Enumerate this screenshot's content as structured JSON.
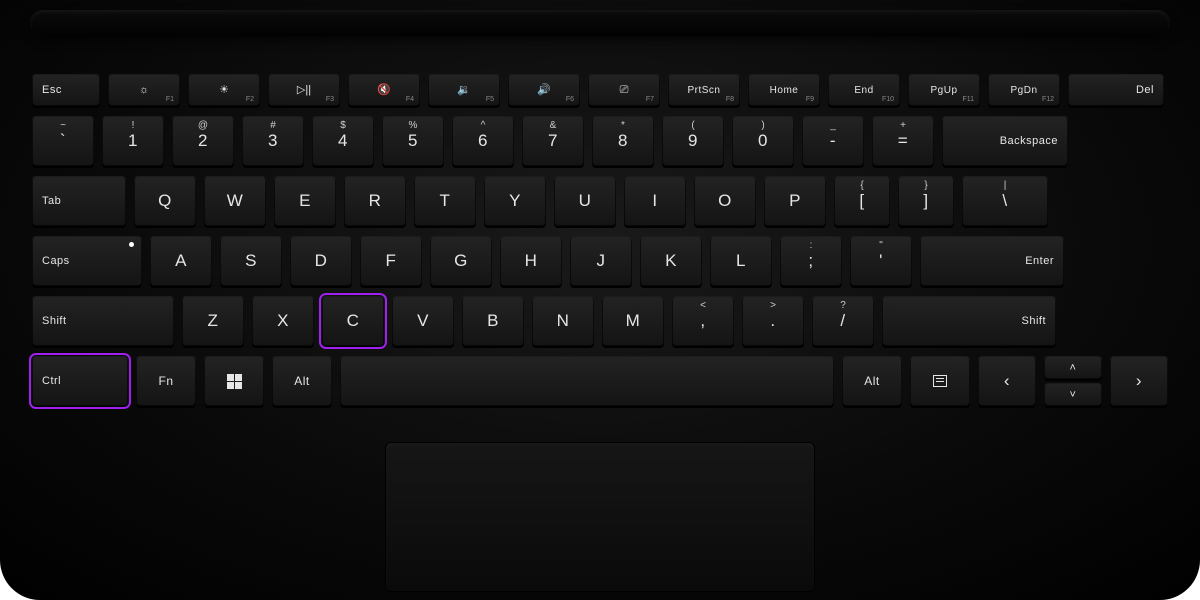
{
  "highlight_color": "#a020f0",
  "rows": {
    "fn": {
      "esc": "Esc",
      "f1": {
        "icon": "brightness-down-icon",
        "glyph": "☼",
        "sub": "F1"
      },
      "f2": {
        "icon": "brightness-up-icon",
        "glyph": "☀",
        "sub": "F2"
      },
      "f3": {
        "icon": "play-pause-icon",
        "glyph": "▷||",
        "sub": "F3"
      },
      "f4": {
        "icon": "mute-icon",
        "glyph": "🔇",
        "sub": "F4"
      },
      "f5": {
        "icon": "volume-down-icon",
        "glyph": "🔉",
        "sub": "F5"
      },
      "f6": {
        "icon": "volume-up-icon",
        "glyph": "🔊",
        "sub": "F6"
      },
      "f7": {
        "icon": "kbd-backlight-icon",
        "glyph": "⎚",
        "sub": "F7"
      },
      "f8": {
        "label": "PrtScn",
        "sub": "F8"
      },
      "f9": {
        "label": "Home",
        "sub": "F9"
      },
      "f10": {
        "label": "End",
        "sub": "F10"
      },
      "f11": {
        "label": "PgUp",
        "sub": "F11"
      },
      "f12": {
        "label": "PgDn",
        "sub": "F12"
      },
      "del": "Del"
    },
    "num": {
      "k1": {
        "top": "~",
        "main": "`"
      },
      "k2": {
        "top": "!",
        "main": "1"
      },
      "k3": {
        "top": "@",
        "main": "2"
      },
      "k4": {
        "top": "#",
        "main": "3"
      },
      "k5": {
        "top": "$",
        "main": "4"
      },
      "k6": {
        "top": "%",
        "main": "5"
      },
      "k7": {
        "top": "^",
        "main": "6"
      },
      "k8": {
        "top": "&",
        "main": "7"
      },
      "k9": {
        "top": "*",
        "main": "8"
      },
      "k10": {
        "top": "(",
        "main": "9"
      },
      "k11": {
        "top": ")",
        "main": "0"
      },
      "k12": {
        "top": "_",
        "main": "-"
      },
      "k13": {
        "top": "+",
        "main": "="
      },
      "bksp": "Backspace"
    },
    "qw": {
      "tab": "Tab",
      "letters": [
        "Q",
        "W",
        "E",
        "R",
        "T",
        "Y",
        "U",
        "I",
        "O",
        "P"
      ],
      "br1": {
        "top": "{",
        "main": "["
      },
      "br2": {
        "top": "}",
        "main": "]"
      },
      "pipe": {
        "top": "|",
        "main": "\\"
      }
    },
    "as": {
      "caps": "Caps",
      "letters": [
        "A",
        "S",
        "D",
        "F",
        "G",
        "H",
        "J",
        "K",
        "L"
      ],
      "semi": {
        "top": ":",
        "main": ";"
      },
      "quote": {
        "top": "\"",
        "main": "'"
      },
      "enter": "Enter"
    },
    "zx": {
      "shiftL": "Shift",
      "letters": [
        "Z",
        "X",
        "C",
        "V",
        "B",
        "N",
        "M"
      ],
      "comma": {
        "top": "<",
        "main": ","
      },
      "period": {
        "top": ">",
        "main": "."
      },
      "slash": {
        "top": "?",
        "main": "/"
      },
      "shiftR": "Shift"
    },
    "mod": {
      "ctrl": "Ctrl",
      "fn": "Fn",
      "win": {
        "icon": "windows-icon"
      },
      "altL": "Alt",
      "altR": "Alt",
      "menu": {
        "icon": "menu-icon"
      },
      "left": "‹",
      "up": "˄",
      "down": "˅",
      "right": "›"
    }
  },
  "highlighted_keys": [
    "ctrl",
    "C"
  ]
}
